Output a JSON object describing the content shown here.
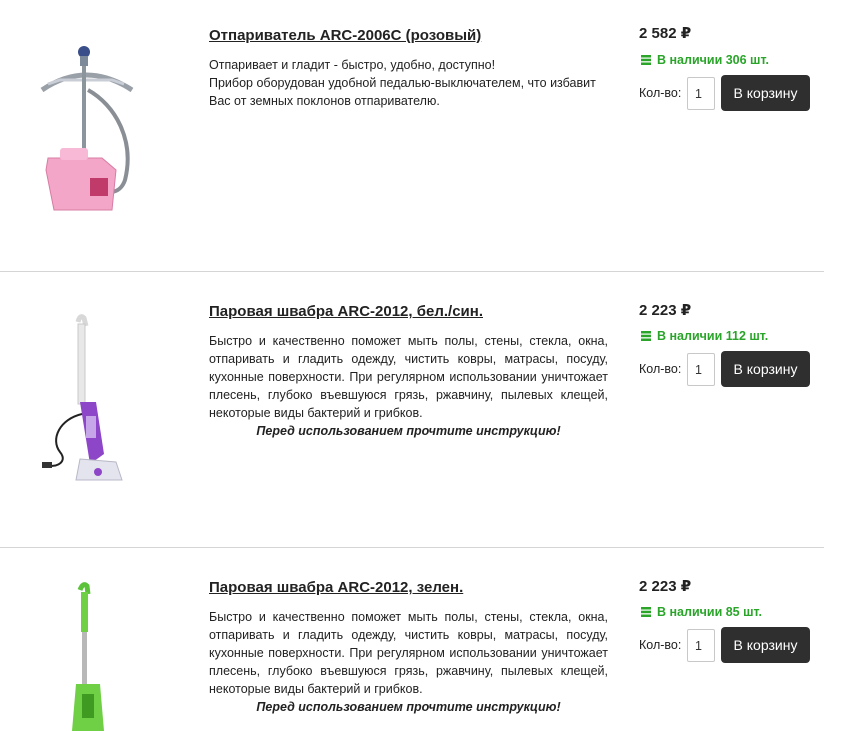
{
  "currency_symbol": "₽",
  "colors": {
    "stock_green": "#2aa52a",
    "button_bg": "#2f2f2f",
    "divider": "#d5d5d5"
  },
  "labels": {
    "qty": "Кол-во:",
    "add_to_cart": "В корзину"
  },
  "products": [
    {
      "title": "Отпариватель ARC-2006C (розовый)",
      "description": "Отпаривает и гладит - быстро, удобно, доступно!\nПрибор оборудован удобной педалью-выключателем, что избавит Вас от земных поклонов отпаривателю.",
      "note": "",
      "price": "2 582 ₽",
      "stock": "В наличии 306 шт.",
      "qty": "1",
      "image": "steamer-pink-image"
    },
    {
      "title": "Паровая швабра ARC-2012, бел./син.",
      "description": "Быстро и качественно поможет мыть полы, стены, стекла, окна, отпаривать и гладить одежду, чистить ковры, матрасы, посуду, кухонные поверхности. При регулярном использовании уничтожает плесень, глубоко въевшуюся грязь, ржавчину, пылевых клещей, некоторые виды бактерий и грибков.",
      "note": "Перед использованием прочтите инструкцию!",
      "price": "2 223 ₽",
      "stock": "В наличии 112 шт.",
      "qty": "1",
      "image": "steam-mop-white-violet-image"
    },
    {
      "title": "Паровая швабра ARC-2012, зелен.",
      "description": "Быстро и качественно поможет мыть полы, стены, стекла, окна, отпаривать и гладить одежду, чистить ковры, матрасы, посуду, кухонные поверхности. При регулярном использовании уничтожает плесень, глубоко въевшуюся грязь, ржавчину, пылевых клещей, некоторые виды бактерий и грибков.",
      "note": "Перед использованием прочтите инструкцию!",
      "price": "2 223 ₽",
      "stock": "В наличии 85 шт.",
      "qty": "1",
      "image": "steam-mop-green-image"
    }
  ]
}
